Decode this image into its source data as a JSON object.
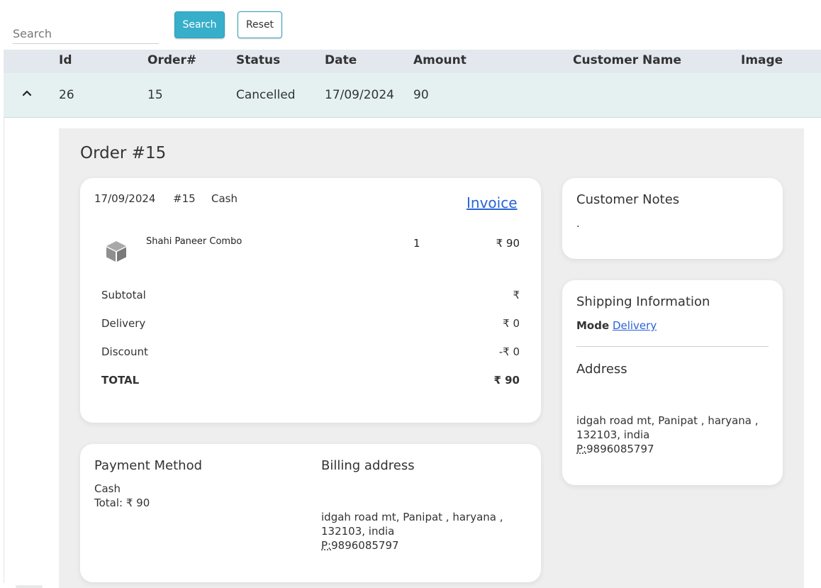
{
  "search": {
    "placeholder": "Search",
    "search_label": "Search",
    "reset_label": "Reset"
  },
  "table": {
    "columns": [
      "Id",
      "Order#",
      "Status",
      "Date",
      "Amount",
      "Customer Name",
      "Image"
    ],
    "row": {
      "id": "26",
      "order": "15",
      "status": "Cancelled",
      "date": "17/09/2024",
      "amount": "90",
      "customer_name": "",
      "image": ""
    }
  },
  "order": {
    "title": "Order #15",
    "date": "17/09/2024",
    "number": "#15",
    "method": "Cash",
    "invoice_label": "Invoice",
    "items": [
      {
        "name": "Shahi Paneer Combo",
        "qty": "1",
        "price": "₹ 90",
        "icon": "box-icon"
      }
    ],
    "summary": {
      "subtotal_label": "Subtotal",
      "subtotal_value": "₹",
      "delivery_label": "Delivery",
      "delivery_value": "₹ 0",
      "discount_label": "Discount",
      "discount_value": "-₹ 0",
      "total_label": "TOTAL",
      "total_value": "₹ 90"
    },
    "payment": {
      "title": "Payment Method",
      "method": "Cash",
      "total": "Total: ₹ 90"
    },
    "billing": {
      "title": "Billing address",
      "line1": "idgah road mt, Panipat , haryana ,",
      "line2": "132103, india",
      "phone_prefix": "P:",
      "phone": "9896085797"
    },
    "notes": {
      "title": "Customer Notes",
      "text": "."
    },
    "shipping": {
      "title": "Shipping Information",
      "mode_label": "Mode",
      "mode_value": "Delivery",
      "address_title": "Address",
      "line1": "idgah road mt, Panipat , haryana ,",
      "line2": "132103, india",
      "phone_prefix": "P:",
      "phone": "9896085797"
    }
  },
  "colors": {
    "primary": "#38afca",
    "header_bg": "#e3e7ee",
    "row_bg": "#e5f1f1",
    "detail_bg": "#eeeeee",
    "link": "#2a63d6"
  }
}
